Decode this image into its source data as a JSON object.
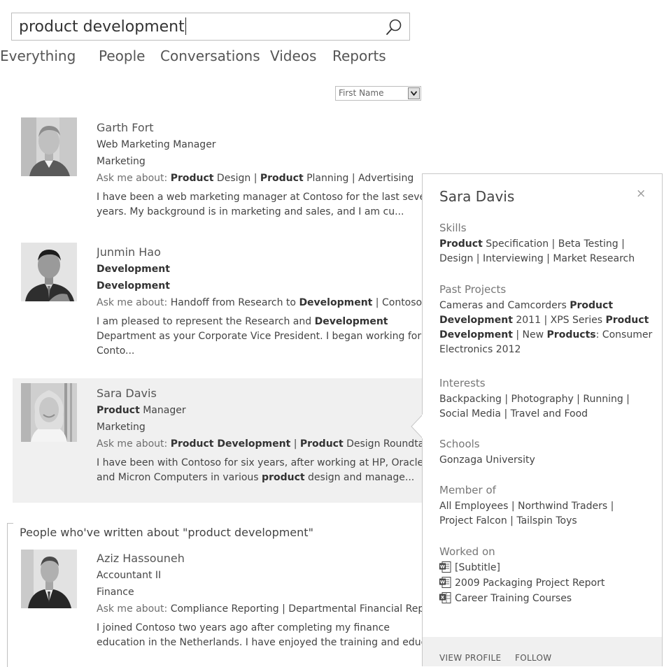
{
  "search": {
    "value": "product development"
  },
  "tabs": [
    "Everything",
    "People",
    "Conversations",
    "Videos",
    "Reports"
  ],
  "sort": {
    "selected": "First Name"
  },
  "results": [
    {
      "name": "Garth Fort",
      "title": [
        {
          "t": "Web Marketing Manager",
          "b": false
        }
      ],
      "department": [
        {
          "t": "Marketing",
          "b": false
        }
      ],
      "ask_prefix": "Ask me about: ",
      "ask": [
        {
          "t": "Product",
          "b": true
        },
        {
          "t": " Design | ",
          "b": false
        },
        {
          "t": "Product",
          "b": true
        },
        {
          "t": " Planning | Advertising",
          "b": false
        }
      ],
      "desc_lines": [
        [
          {
            "t": "I have been a web marketing manager at Contoso for the last seven",
            "b": false
          }
        ],
        [
          {
            "t": "years. My background is in marketing and sales, and I am cu...",
            "b": false
          }
        ]
      ]
    },
    {
      "name": "Junmin Hao",
      "title": [
        {
          "t": "Development",
          "b": true
        }
      ],
      "department": [
        {
          "t": "Development",
          "b": true
        }
      ],
      "ask_prefix": "Ask me about: ",
      "ask": [
        {
          "t": "Handoff from Research to ",
          "b": false
        },
        {
          "t": "Development",
          "b": true
        },
        {
          "t": " | Contoso...",
          "b": false
        }
      ],
      "desc_lines": [
        [
          {
            "t": "I am pleased to represent the Research and ",
            "b": false
          },
          {
            "t": "Development",
            "b": true
          }
        ],
        [
          {
            "t": "Department as your Corporate Vice President. I began working for",
            "b": false
          }
        ],
        [
          {
            "t": "Conto...",
            "b": false
          }
        ]
      ]
    },
    {
      "name": "Sara Davis",
      "title": [
        {
          "t": "Product",
          "b": true
        },
        {
          "t": " Manager",
          "b": false
        }
      ],
      "department": [
        {
          "t": "Marketing",
          "b": false
        }
      ],
      "ask_prefix": "Ask me about: ",
      "ask": [
        {
          "t": "Product Development",
          "b": true
        },
        {
          "t": " | ",
          "b": false
        },
        {
          "t": "Product",
          "b": true
        },
        {
          "t": " Design Roundtabl...",
          "b": false
        }
      ],
      "desc_lines": [
        [
          {
            "t": "I have been with Contoso for six years, after working at HP, Oracle",
            "b": false
          }
        ],
        [
          {
            "t": "and Micron Computers in various ",
            "b": false
          },
          {
            "t": "product",
            "b": true
          },
          {
            "t": " design and manage...",
            "b": false
          }
        ]
      ]
    },
    {
      "name": "Aziz Hassouneh",
      "title": [
        {
          "t": "Accountant II",
          "b": false
        }
      ],
      "department": [
        {
          "t": "Finance",
          "b": false
        }
      ],
      "ask_prefix": "Ask me about: ",
      "ask": [
        {
          "t": "Compliance Reporting | Departmental Financial Rep...",
          "b": false
        }
      ],
      "desc_lines": [
        [
          {
            "t": "I joined Contoso two years ago after completing my finance",
            "b": false
          }
        ],
        [
          {
            "t": "education in the Netherlands. I have enjoyed the training and educ...",
            "b": false
          }
        ]
      ]
    }
  ],
  "written_about_heading": "People who've written about \"product development\"",
  "card": {
    "name": "Sara Davis",
    "close_glyph": "×",
    "sections": [
      {
        "heading": "Skills",
        "lines": [
          [
            {
              "t": "Product",
              "b": true
            },
            {
              "t": " Specification | Beta Testing |",
              "b": false
            }
          ],
          [
            {
              "t": "Design | Interviewing | Market Research",
              "b": false
            }
          ]
        ]
      },
      {
        "heading": "Past Projects",
        "lines": [
          [
            {
              "t": "Cameras and Camcorders ",
              "b": false
            },
            {
              "t": "Product",
              "b": true
            }
          ],
          [
            {
              "t": "Development",
              "b": true
            },
            {
              "t": " 2011 | XPS Series ",
              "b": false
            },
            {
              "t": "Product",
              "b": true
            }
          ],
          [
            {
              "t": "Development",
              "b": true
            },
            {
              "t": " | New ",
              "b": false
            },
            {
              "t": "Products",
              "b": true
            },
            {
              "t": ": Consumer",
              "b": false
            }
          ],
          [
            {
              "t": "Electronics 2012",
              "b": false
            }
          ]
        ]
      },
      {
        "heading": "Interests",
        "lines": [
          [
            {
              "t": "Backpacking | Photography | Running |",
              "b": false
            }
          ],
          [
            {
              "t": "Social Media | Travel and Food",
              "b": false
            }
          ]
        ]
      },
      {
        "heading": "Schools",
        "lines": [
          [
            {
              "t": "Gonzaga University",
              "b": false
            }
          ]
        ]
      },
      {
        "heading": "Member of",
        "lines": [
          [
            {
              "t": "All Employees | Northwind Traders |",
              "b": false
            }
          ],
          [
            {
              "t": "Project Falcon | Tailspin Toys",
              "b": false
            }
          ]
        ]
      }
    ],
    "worked_on_heading": "Worked on",
    "worked_on": [
      {
        "label": "[Subtitle]",
        "icon": "word-document-icon"
      },
      {
        "label": "2009 Packaging Project Report",
        "icon": "word-document-icon"
      },
      {
        "label": "Career Training Courses",
        "icon": "excel-document-icon"
      }
    ],
    "actions": {
      "view_profile": "VIEW PROFILE",
      "follow": "FOLLOW"
    }
  },
  "colors": {
    "selected_row": "#f0f0f0",
    "card_footer": "#f0f0f0",
    "border": "#c8c8c8"
  }
}
